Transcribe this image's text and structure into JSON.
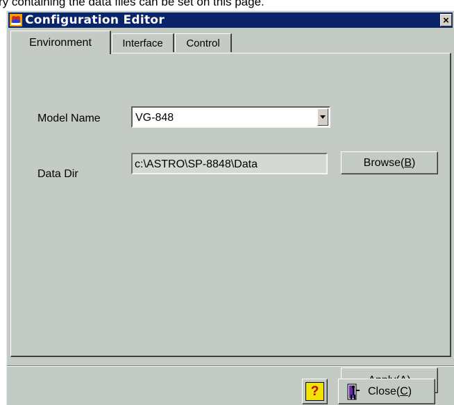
{
  "caption": "ry containing the data files can be set on this page.",
  "window": {
    "title": "Configuration Editor",
    "close_glyph": "×"
  },
  "tabs": [
    {
      "label": "Environment",
      "active": true
    },
    {
      "label": "Interface",
      "active": false
    },
    {
      "label": "Control",
      "active": false
    }
  ],
  "form": {
    "model_name_label": "Model Name",
    "model_name_value": "VG-848",
    "data_dir_label": "Data Dir",
    "data_dir_value": "c:\\ASTRO\\SP-8848\\Data"
  },
  "buttons": {
    "browse_prefix": "Browse(",
    "browse_key": "B",
    "browse_suffix": ")",
    "apply_prefix": "Apply(",
    "apply_key": "A",
    "apply_suffix": ")",
    "help_glyph": "?",
    "close_prefix": "Close(",
    "close_key": "C",
    "close_suffix": ")"
  },
  "icons": {
    "app": "app-icon",
    "close": "close-icon",
    "dropdown": "chevron-down-icon",
    "help": "help-icon",
    "exit": "exit-door-icon"
  },
  "colors": {
    "titlebar": "#0a246a",
    "window_face": "#c4cbc4",
    "help_yellow": "#f2e200",
    "help_mark": "#c00000"
  }
}
